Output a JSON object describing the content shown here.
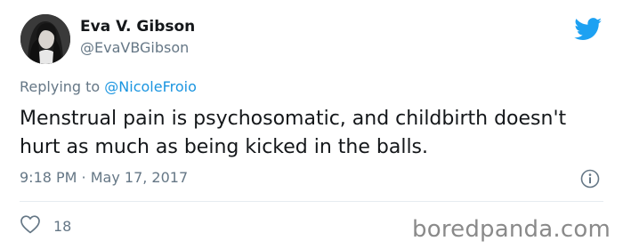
{
  "tweet": {
    "author": {
      "display_name": "Eva V. Gibson",
      "handle": "@EvaVBGibson"
    },
    "reply": {
      "prefix": "Replying to",
      "mention": "@NicoleFroio"
    },
    "text": "Menstrual pain is psychosomatic, and childbirth doesn't hurt as much as being kicked in the balls.",
    "timestamp": "9:18 PM · May 17, 2017",
    "likes": "18"
  },
  "icons": {
    "brand": "twitter-bird-icon",
    "info": "info-icon",
    "like": "heart-icon"
  },
  "colors": {
    "twitter_blue": "#1da1f2",
    "mention": "#1b95e0",
    "secondary_text": "#657786",
    "primary_text": "#14171a"
  },
  "watermark": "boredpanda.com"
}
